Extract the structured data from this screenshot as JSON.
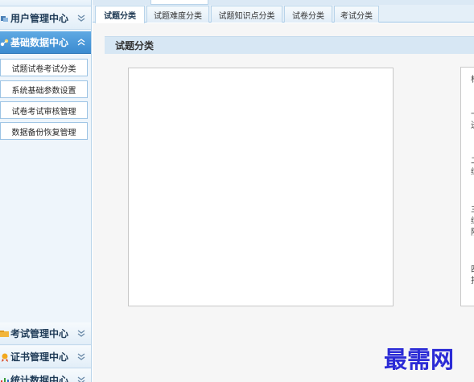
{
  "sidebar": {
    "sections": [
      {
        "label": "用户管理中心",
        "icon": "users-icon",
        "expanded": false
      },
      {
        "label": "基础数据中心",
        "icon": "data-nodes-icon",
        "expanded": true
      },
      {
        "label": "考试管理中心",
        "icon": "folder-icon",
        "expanded": false
      },
      {
        "label": "证书管理中心",
        "icon": "certificate-icon",
        "expanded": false
      },
      {
        "label": "统计数据中心",
        "icon": "chart-icon",
        "expanded": false
      }
    ],
    "subitems": [
      "试题试卷考试分类",
      "系统基础参数设置",
      "试卷考试审核管理",
      "数据备份恢复管理"
    ]
  },
  "tabs": [
    {
      "label": "试题分类",
      "active": true
    },
    {
      "label": "试题难度分类",
      "active": false
    },
    {
      "label": "试题知识点分类",
      "active": false
    },
    {
      "label": "试卷分类",
      "active": false
    },
    {
      "label": "考试分类",
      "active": false
    }
  ],
  "main": {
    "section_title": "试题分类"
  },
  "right_panel_chars": [
    "标",
    "一",
    "送",
    "二",
    "练",
    "三",
    "练",
    "阶",
    "四",
    "打"
  ],
  "watermark": "最需网",
  "colors": {
    "active_header": "#3b8bd0",
    "accent_border": "#9cc3e4",
    "section_bar": "#d7e7f4",
    "watermark": "#2b2bd6"
  }
}
